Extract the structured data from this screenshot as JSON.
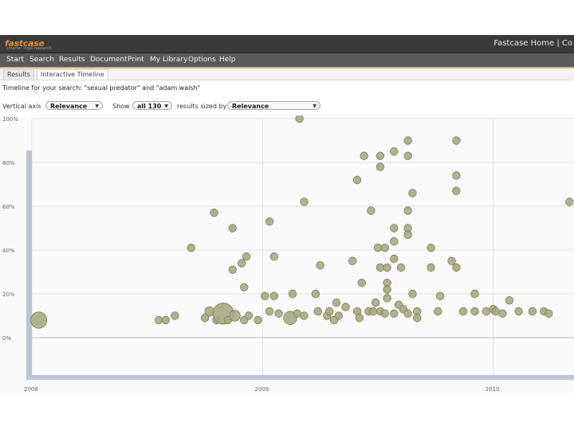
{
  "app": {
    "logo_text": "fastcase",
    "logo_sub": "smarter legal research",
    "title_right": "Fastcase Home | Co"
  },
  "menu": [
    {
      "label": "Start"
    },
    {
      "label": "Search"
    },
    {
      "label": "Results"
    },
    {
      "label": "Document"
    },
    {
      "label": "Print"
    },
    {
      "label": "My Library"
    },
    {
      "label": "Options"
    },
    {
      "label": "Help"
    }
  ],
  "tabs": [
    {
      "label": "Results",
      "active": false
    },
    {
      "label": "Interactive Timeline",
      "active": true
    }
  ],
  "caption": "Timeline for your search: \"sexual predator\" and \"adam walsh\"",
  "controls": {
    "vertical_axis_label": "Vertical axis",
    "vertical_axis_value": "Relevance",
    "show_label": "Show",
    "show_value": "all 130",
    "results_sized_label": "results sized by",
    "sized_by_value": "Relevance"
  },
  "chart_data": {
    "type": "scatter",
    "xlabel": "",
    "ylabel": "Relevance",
    "x_ticks": [
      "2008",
      "2009",
      "2010"
    ],
    "x_range": [
      2008.0,
      2010.35
    ],
    "y_ticks": [
      "0%",
      "20%",
      "40%",
      "60%",
      "80%",
      "100%"
    ],
    "y_ticks_values": [
      0,
      20,
      40,
      60,
      80,
      100
    ],
    "ylim": [
      -12,
      100
    ],
    "grid": true,
    "colors": {
      "bubble_fill": "#a8a884",
      "bubble_stroke": "#7e7e5c",
      "axis": "#b9c6d4",
      "grid": "#e3e3e3"
    },
    "points": [
      {
        "x": 2008.03,
        "y": 8,
        "s": 9
      },
      {
        "x": 2008.55,
        "y": 8,
        "s": 2
      },
      {
        "x": 2008.58,
        "y": 8,
        "s": 2
      },
      {
        "x": 2008.62,
        "y": 10,
        "s": 2
      },
      {
        "x": 2008.69,
        "y": 41,
        "s": 2
      },
      {
        "x": 2008.75,
        "y": 9,
        "s": 2
      },
      {
        "x": 2008.77,
        "y": 12,
        "s": 3
      },
      {
        "x": 2008.79,
        "y": 57,
        "s": 2
      },
      {
        "x": 2008.8,
        "y": 8,
        "s": 2
      },
      {
        "x": 2008.83,
        "y": 11,
        "s": 15
      },
      {
        "x": 2008.85,
        "y": 8,
        "s": 2
      },
      {
        "x": 2008.87,
        "y": 50,
        "s": 2
      },
      {
        "x": 2008.87,
        "y": 31,
        "s": 2
      },
      {
        "x": 2008.88,
        "y": 10,
        "s": 4
      },
      {
        "x": 2008.91,
        "y": 34,
        "s": 2
      },
      {
        "x": 2008.92,
        "y": 23,
        "s": 2
      },
      {
        "x": 2008.92,
        "y": 8,
        "s": 2
      },
      {
        "x": 2008.93,
        "y": 37,
        "s": 2
      },
      {
        "x": 2008.94,
        "y": 10,
        "s": 2
      },
      {
        "x": 2008.98,
        "y": 8,
        "s": 2
      },
      {
        "x": 2009.01,
        "y": 19,
        "s": 2
      },
      {
        "x": 2009.03,
        "y": 53,
        "s": 2
      },
      {
        "x": 2009.03,
        "y": 12,
        "s": 2
      },
      {
        "x": 2009.05,
        "y": 19,
        "s": 2
      },
      {
        "x": 2009.05,
        "y": 37,
        "s": 2
      },
      {
        "x": 2009.07,
        "y": 11,
        "s": 2
      },
      {
        "x": 2009.12,
        "y": 9,
        "s": 6
      },
      {
        "x": 2009.13,
        "y": 20,
        "s": 2
      },
      {
        "x": 2009.15,
        "y": 11,
        "s": 2
      },
      {
        "x": 2009.16,
        "y": 100,
        "s": 2
      },
      {
        "x": 2009.18,
        "y": 62,
        "s": 2
      },
      {
        "x": 2009.18,
        "y": 10,
        "s": 2
      },
      {
        "x": 2009.23,
        "y": 20,
        "s": 2
      },
      {
        "x": 2009.24,
        "y": 12,
        "s": 2
      },
      {
        "x": 2009.25,
        "y": 33,
        "s": 2
      },
      {
        "x": 2009.28,
        "y": 10,
        "s": 2
      },
      {
        "x": 2009.29,
        "y": 12,
        "s": 2
      },
      {
        "x": 2009.31,
        "y": 8,
        "s": 2
      },
      {
        "x": 2009.32,
        "y": 16,
        "s": 2
      },
      {
        "x": 2009.33,
        "y": 10,
        "s": 2
      },
      {
        "x": 2009.36,
        "y": 14,
        "s": 2
      },
      {
        "x": 2009.39,
        "y": 35,
        "s": 2
      },
      {
        "x": 2009.41,
        "y": 12,
        "s": 2
      },
      {
        "x": 2009.41,
        "y": 72,
        "s": 2
      },
      {
        "x": 2009.42,
        "y": 9,
        "s": 2
      },
      {
        "x": 2009.43,
        "y": 25,
        "s": 2
      },
      {
        "x": 2009.44,
        "y": 83,
        "s": 2
      },
      {
        "x": 2009.46,
        "y": 12,
        "s": 2
      },
      {
        "x": 2009.47,
        "y": 58,
        "s": 2
      },
      {
        "x": 2009.48,
        "y": 12,
        "s": 2
      },
      {
        "x": 2009.49,
        "y": 16,
        "s": 2
      },
      {
        "x": 2009.5,
        "y": 41,
        "s": 2
      },
      {
        "x": 2009.51,
        "y": 32,
        "s": 2
      },
      {
        "x": 2009.51,
        "y": 83,
        "s": 2
      },
      {
        "x": 2009.51,
        "y": 78,
        "s": 2
      },
      {
        "x": 2009.51,
        "y": 12,
        "s": 2
      },
      {
        "x": 2009.53,
        "y": 11,
        "s": 2
      },
      {
        "x": 2009.53,
        "y": 41,
        "s": 2
      },
      {
        "x": 2009.54,
        "y": 32,
        "s": 2
      },
      {
        "x": 2009.54,
        "y": 25,
        "s": 2
      },
      {
        "x": 2009.54,
        "y": 22,
        "s": 2
      },
      {
        "x": 2009.54,
        "y": 18,
        "s": 2
      },
      {
        "x": 2009.57,
        "y": 85,
        "s": 2
      },
      {
        "x": 2009.57,
        "y": 50,
        "s": 2
      },
      {
        "x": 2009.57,
        "y": 44,
        "s": 2
      },
      {
        "x": 2009.57,
        "y": 36,
        "s": 2
      },
      {
        "x": 2009.57,
        "y": 11,
        "s": 2
      },
      {
        "x": 2009.59,
        "y": 15,
        "s": 2
      },
      {
        "x": 2009.6,
        "y": 32,
        "s": 2
      },
      {
        "x": 2009.61,
        "y": 13,
        "s": 2
      },
      {
        "x": 2009.63,
        "y": 90,
        "s": 2
      },
      {
        "x": 2009.63,
        "y": 83,
        "s": 2
      },
      {
        "x": 2009.63,
        "y": 58,
        "s": 2
      },
      {
        "x": 2009.63,
        "y": 50,
        "s": 2
      },
      {
        "x": 2009.63,
        "y": 47,
        "s": 2
      },
      {
        "x": 2009.63,
        "y": 11,
        "s": 2
      },
      {
        "x": 2009.65,
        "y": 66,
        "s": 2
      },
      {
        "x": 2009.65,
        "y": 20,
        "s": 2
      },
      {
        "x": 2009.67,
        "y": 12,
        "s": 2
      },
      {
        "x": 2009.67,
        "y": 9,
        "s": 2
      },
      {
        "x": 2009.73,
        "y": 32,
        "s": 2
      },
      {
        "x": 2009.73,
        "y": 41,
        "s": 2
      },
      {
        "x": 2009.76,
        "y": 12,
        "s": 2
      },
      {
        "x": 2009.77,
        "y": 19,
        "s": 2
      },
      {
        "x": 2009.82,
        "y": 35,
        "s": 2
      },
      {
        "x": 2009.84,
        "y": 90,
        "s": 2
      },
      {
        "x": 2009.84,
        "y": 74,
        "s": 2
      },
      {
        "x": 2009.84,
        "y": 67,
        "s": 2
      },
      {
        "x": 2009.84,
        "y": 32,
        "s": 2
      },
      {
        "x": 2009.87,
        "y": 12,
        "s": 2
      },
      {
        "x": 2009.92,
        "y": 20,
        "s": 2
      },
      {
        "x": 2009.92,
        "y": 12,
        "s": 2
      },
      {
        "x": 2009.97,
        "y": 12,
        "s": 2
      },
      {
        "x": 2010.0,
        "y": 13,
        "s": 2
      },
      {
        "x": 2010.01,
        "y": 12,
        "s": 2
      },
      {
        "x": 2010.04,
        "y": 11,
        "s": 2
      },
      {
        "x": 2010.07,
        "y": 17,
        "s": 2
      },
      {
        "x": 2010.11,
        "y": 12,
        "s": 2
      },
      {
        "x": 2010.17,
        "y": 12,
        "s": 2
      },
      {
        "x": 2010.22,
        "y": 12,
        "s": 2
      },
      {
        "x": 2010.24,
        "y": 11,
        "s": 2
      },
      {
        "x": 2010.33,
        "y": 62,
        "s": 2
      }
    ]
  }
}
